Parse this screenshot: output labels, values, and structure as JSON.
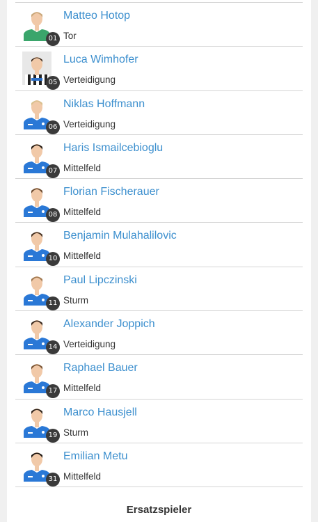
{
  "players": [
    {
      "name": "Matteo Hotop",
      "position": "Tor",
      "number": "01",
      "kit": "green",
      "hair": "#c9a77a",
      "photo_icon": "player-photo-goalkeeper"
    },
    {
      "name": "Luca Wimhofer",
      "position": "Verteidigung",
      "number": "05",
      "kit": "striped",
      "hair": "#3b2a1e",
      "photo_icon": "player-photo-striped-kit"
    },
    {
      "name": "Niklas Hoffmann",
      "position": "Verteidigung",
      "number": "06",
      "kit": "blue",
      "hair": "#d9c08e",
      "photo_icon": "player-photo-blue-kit"
    },
    {
      "name": "Haris Ismailcebioglu",
      "position": "Mittelfeld",
      "number": "07",
      "kit": "blue",
      "hair": "#2b2018",
      "photo_icon": "player-photo-blue-kit"
    },
    {
      "name": "Florian Fischerauer",
      "position": "Mittelfeld",
      "number": "08",
      "kit": "blue",
      "hair": "#6b4a2e",
      "photo_icon": "player-photo-blue-kit"
    },
    {
      "name": "Benjamin Mulahalilovic",
      "position": "Mittelfeld",
      "number": "10",
      "kit": "blue",
      "hair": "#4a3526",
      "photo_icon": "player-photo-blue-kit"
    },
    {
      "name": "Paul Lipczinski",
      "position": "Sturm",
      "number": "11",
      "kit": "blue",
      "hair": "#a07850",
      "photo_icon": "player-photo-blue-kit"
    },
    {
      "name": "Alexander Joppich",
      "position": "Verteidigung",
      "number": "14",
      "kit": "blue",
      "hair": "#3a2a1f",
      "photo_icon": "player-photo-blue-kit"
    },
    {
      "name": "Raphael Bauer",
      "position": "Mittelfeld",
      "number": "17",
      "kit": "blue",
      "hair": "#7a5535",
      "photo_icon": "player-photo-blue-kit"
    },
    {
      "name": "Marco Hausjell",
      "position": "Sturm",
      "number": "19",
      "kit": "blue",
      "hair": "#2e2219",
      "photo_icon": "player-photo-blue-kit"
    },
    {
      "name": "Emilian Metu",
      "position": "Mittelfeld",
      "number": "31",
      "kit": "blue",
      "hair": "#1e1712",
      "photo_icon": "player-photo-blue-kit"
    }
  ],
  "section": {
    "title": "Ersatzspieler"
  },
  "colors": {
    "name_link": "#3c8fce",
    "kit_blue": "#2a78d6",
    "kit_green": "#3aa56b",
    "badge": "#3a3a3a"
  }
}
